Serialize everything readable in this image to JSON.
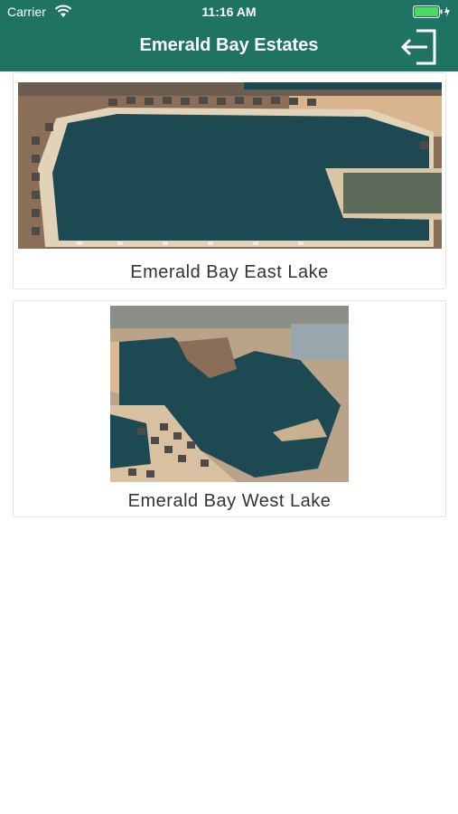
{
  "status_bar": {
    "carrier": "Carrier",
    "time": "11:16 AM",
    "battery_color": "#4cd964"
  },
  "nav": {
    "title": "Emerald Bay Estates",
    "logout_icon": "logout-icon"
  },
  "colors": {
    "header": "#1f7363",
    "water": "#1d4a52",
    "sand": "#d9b48a"
  },
  "lakes": [
    {
      "name": "Emerald Bay East Lake",
      "image": "aerial-lake-photo"
    },
    {
      "name": "Emerald Bay West Lake",
      "image": "aerial-lake-photo"
    }
  ]
}
